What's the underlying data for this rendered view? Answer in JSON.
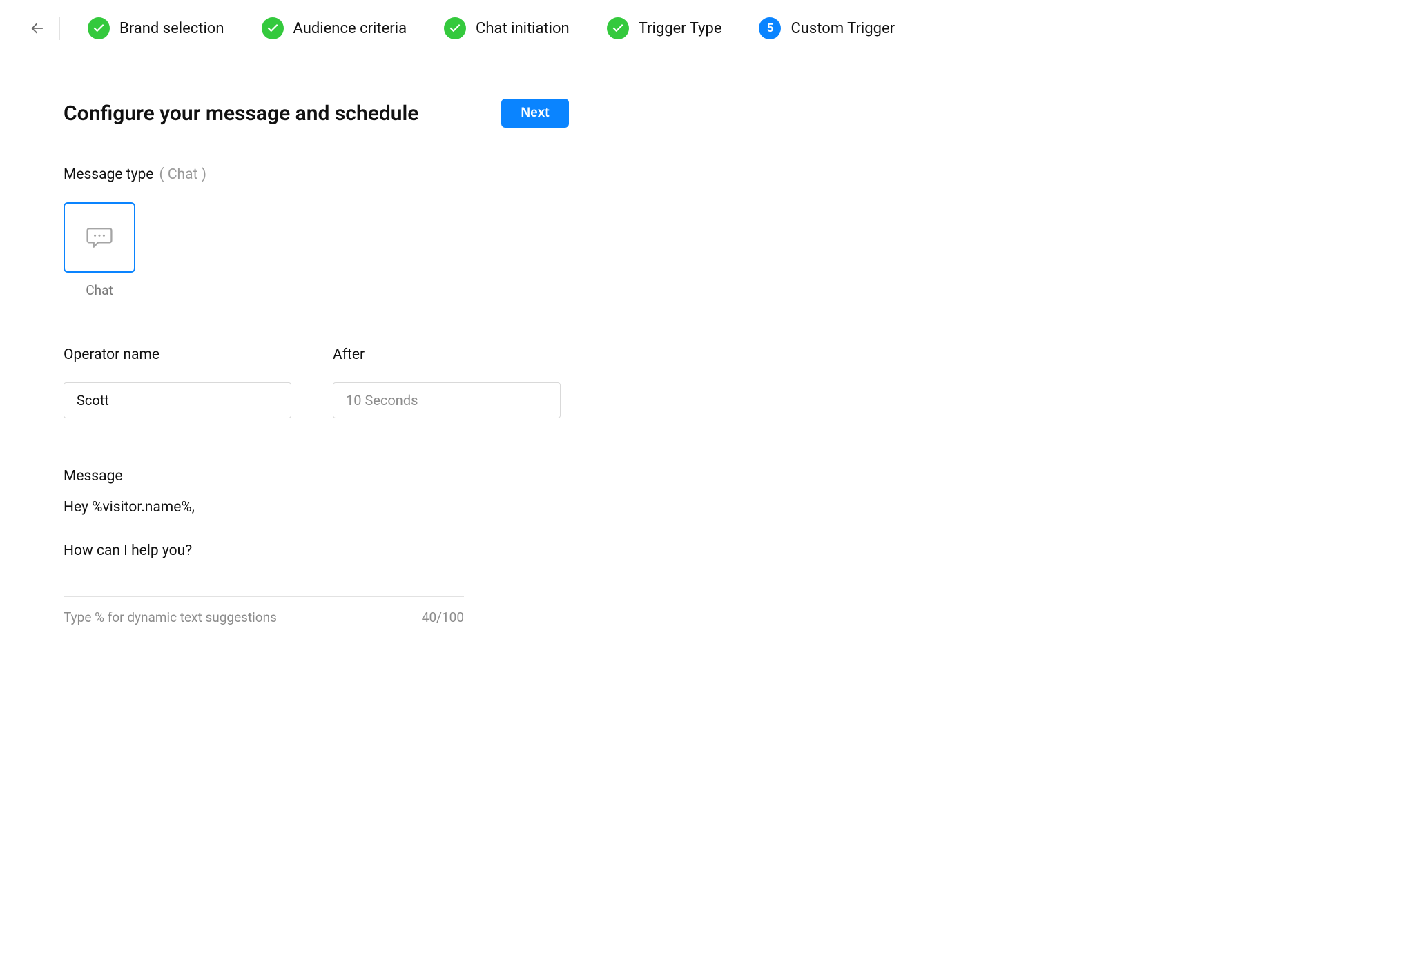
{
  "stepper": {
    "steps": [
      {
        "label": "Brand selection",
        "state": "done"
      },
      {
        "label": "Audience criteria",
        "state": "done"
      },
      {
        "label": "Chat initiation",
        "state": "done"
      },
      {
        "label": "Trigger Type",
        "state": "done"
      },
      {
        "label": "Custom Trigger",
        "state": "current",
        "number": "5"
      }
    ]
  },
  "page": {
    "title": "Configure your message and schedule",
    "next_label": "Next"
  },
  "message_type": {
    "label": "Message type",
    "selected_parenthetical": "( Chat )",
    "options": [
      {
        "label": "Chat",
        "selected": true
      }
    ]
  },
  "operator": {
    "label": "Operator name",
    "value": "Scott"
  },
  "after": {
    "label": "After",
    "value": "10 Seconds"
  },
  "message": {
    "label": "Message",
    "body": "Hey %visitor.name%,\n\nHow can I help you?",
    "hint": "Type % for dynamic text suggestions",
    "counter": "40/100"
  }
}
